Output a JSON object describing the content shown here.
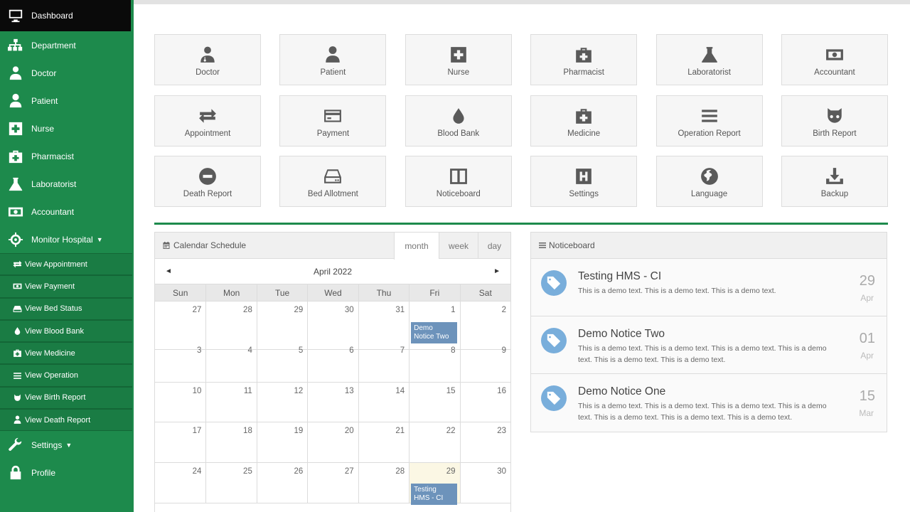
{
  "sidebar": {
    "dashboard": "Dashboard",
    "department": "Department",
    "doctor": "Doctor",
    "patient": "Patient",
    "nurse": "Nurse",
    "pharmacist": "Pharmacist",
    "laboratorist": "Laboratorist",
    "accountant": "Accountant",
    "monitor": "Monitor Hospital",
    "settings": "Settings",
    "profile": "Profile",
    "sub": {
      "appointment": "View Appointment",
      "payment": "View Payment",
      "bed": "View Bed Status",
      "blood": "View Blood Bank",
      "medicine": "View Medicine",
      "operation": "View Operation",
      "birth": "View Birth Report",
      "death": "View Death Report"
    }
  },
  "tiles": {
    "doctor": "Doctor",
    "patient": "Patient",
    "nurse": "Nurse",
    "pharmacist": "Pharmacist",
    "laboratorist": "Laboratorist",
    "accountant": "Accountant",
    "appointment": "Appointment",
    "payment": "Payment",
    "blood_bank": "Blood Bank",
    "medicine": "Medicine",
    "operation_report": "Operation Report",
    "birth_report": "Birth Report",
    "death_report": "Death Report",
    "bed_allotment": "Bed Allotment",
    "noticeboard": "Noticeboard",
    "settings": "Settings",
    "language": "Language",
    "backup": "Backup"
  },
  "calendar": {
    "title": "Calendar Schedule",
    "tabs": {
      "month": "month",
      "week": "week",
      "day": "day"
    },
    "month_label": "April 2022",
    "prev": "◄",
    "next": "►",
    "dow": {
      "sun": "Sun",
      "mon": "Mon",
      "tue": "Tue",
      "wed": "Wed",
      "thu": "Thu",
      "fri": "Fri",
      "sat": "Sat"
    },
    "days": [
      "27",
      "28",
      "29",
      "30",
      "31",
      "1",
      "2",
      "3",
      "4",
      "5",
      "6",
      "7",
      "8",
      "9",
      "10",
      "11",
      "12",
      "13",
      "14",
      "15",
      "16",
      "17",
      "18",
      "19",
      "20",
      "21",
      "22",
      "23",
      "24",
      "25",
      "26",
      "27",
      "28",
      "29",
      "30"
    ],
    "events": {
      "demo_two": "Demo Notice Two",
      "testing": "Testing HMS - CI"
    }
  },
  "noticeboard": {
    "title": "Noticeboard",
    "items": [
      {
        "title": "Testing HMS - CI",
        "body": "This is a demo text. This is a demo text. This is a demo text.",
        "day": "29",
        "month": "Apr"
      },
      {
        "title": "Demo Notice Two",
        "body": "This is a demo text. This is a demo text. This is a demo text. This is a demo text. This is a demo text. This is a demo text.",
        "day": "01",
        "month": "Apr"
      },
      {
        "title": "Demo Notice One",
        "body": "This is a demo text. This is a demo text. This is a demo text. This is a demo text. This is a demo text. This is a demo text. This is a demo text.",
        "day": "15",
        "month": "Mar"
      }
    ]
  },
  "colors": {
    "sidebar": "#1d8a4c",
    "active": "#0a0a0a",
    "event": "#6d93bb",
    "tag": "#79aedb"
  }
}
